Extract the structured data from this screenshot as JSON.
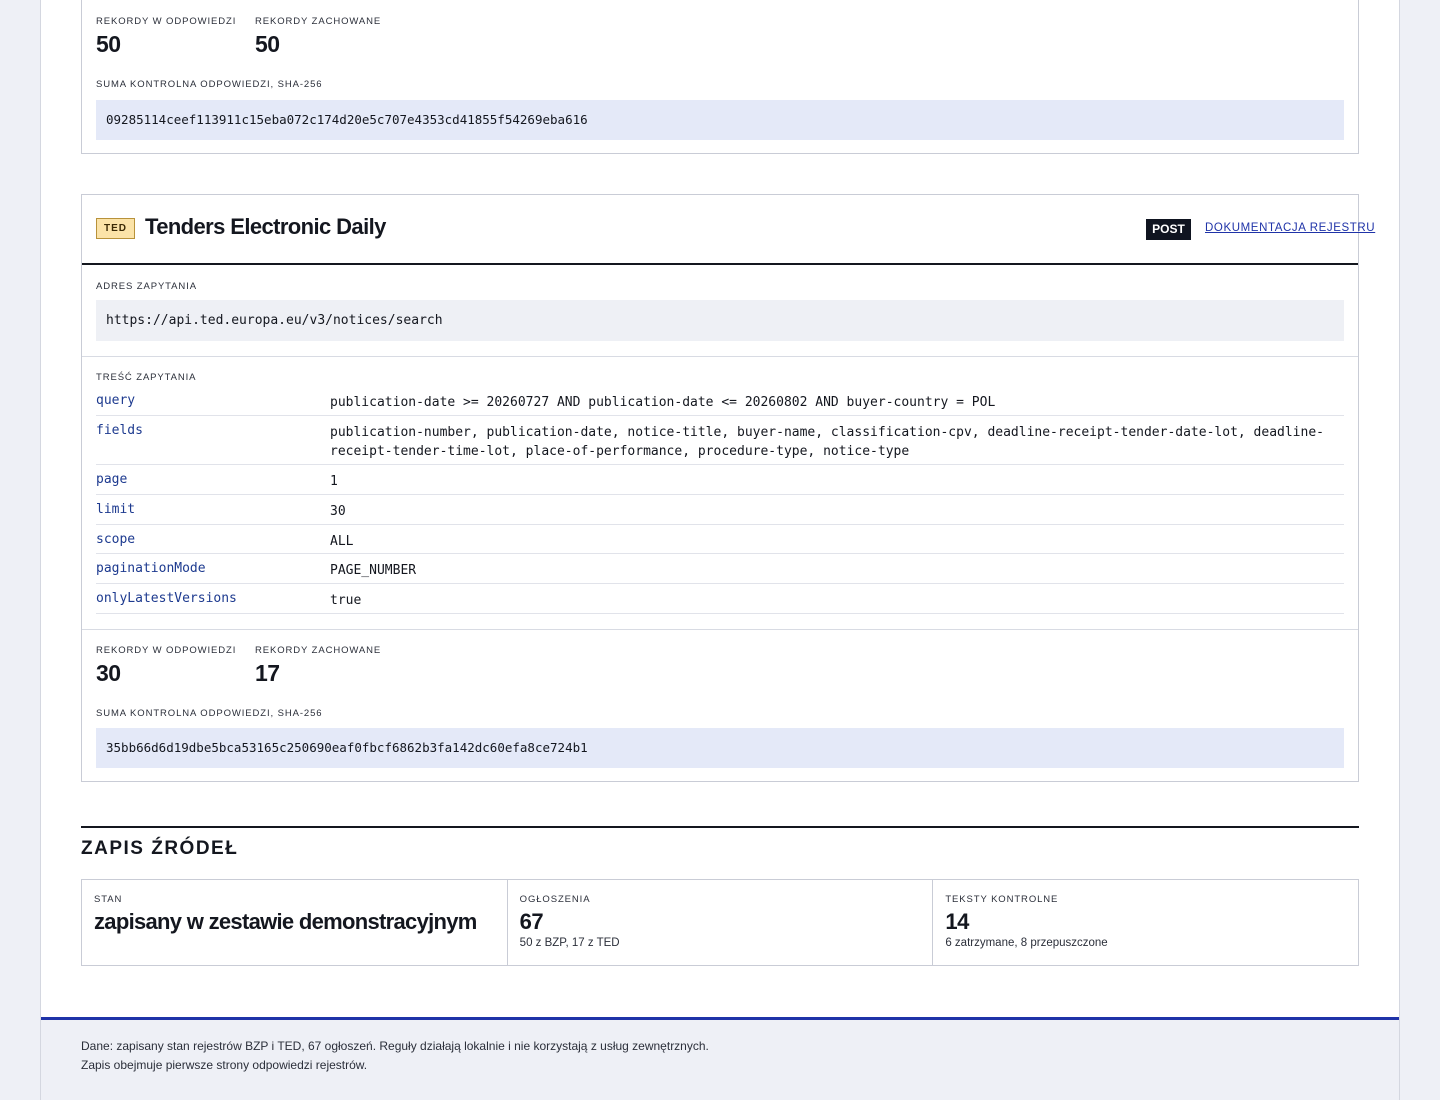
{
  "top_panel": {
    "records_response_label": "REKORDY W ODPOWIEDZI",
    "records_response_value": "50",
    "records_saved_label": "REKORDY ZACHOWANE",
    "records_saved_value": "50",
    "checksum_label": "SUMA KONTROLNA ODPOWIEDZI, SHA-256",
    "checksum_value": "09285114ceef113911c15eba072c174d20e5c707e4353cd41855f54269eba616"
  },
  "ted_panel": {
    "badge": "TED",
    "title": "Tenders Electronic Daily",
    "method": "POST",
    "doc_link": "DOKUMENTACJA REJESTRU",
    "url_label": "ADRES ZAPYTANIA",
    "url_value": "https://api.ted.europa.eu/v3/notices/search",
    "body_label": "TREŚĆ ZAPYTANIA",
    "params": [
      {
        "key": "query",
        "value": "publication-date >= 20260727 AND publication-date <= 20260802 AND buyer-country = POL"
      },
      {
        "key": "fields",
        "value": "publication-number, publication-date, notice-title, buyer-name, classification-cpv, deadline-receipt-tender-date-lot, deadline-receipt-tender-time-lot, place-of-performance, procedure-type, notice-type"
      },
      {
        "key": "page",
        "value": "1"
      },
      {
        "key": "limit",
        "value": "30"
      },
      {
        "key": "scope",
        "value": "ALL"
      },
      {
        "key": "paginationMode",
        "value": "PAGE_NUMBER"
      },
      {
        "key": "onlyLatestVersions",
        "value": "true"
      }
    ],
    "records_response_label": "REKORDY W ODPOWIEDZI",
    "records_response_value": "30",
    "records_saved_label": "REKORDY ZACHOWANE",
    "records_saved_value": "17",
    "checksum_label": "SUMA KONTROLNA ODPOWIEDZI, SHA-256",
    "checksum_value": "35bb66d6d19dbe5bca53165c250690eaf0fbcf6862b3fa142dc60efa8ce724b1"
  },
  "sources": {
    "heading": "ZAPIS ŹRÓDEŁ",
    "cells": [
      {
        "label": "STAN",
        "value": "zapisany w zestawie demonstracyjnym",
        "sub": ""
      },
      {
        "label": "OGŁOSZENIA",
        "value": "67",
        "sub": "50 z BZP, 17 z TED"
      },
      {
        "label": "TEKSTY KONTROLNE",
        "value": "14",
        "sub": "6 zatrzymane, 8 przepuszczone"
      }
    ]
  },
  "footer": {
    "text": "Dane: zapisany stan rejestrów BZP i TED, 67 ogłoszeń. Reguły działają lokalnie i nie korzystają z usług zewnętrznych. Zapis obejmuje pierwsze strony odpowiedzi rejestrów."
  },
  "colors": {
    "accent_blue": "#1f33a8",
    "badge_bg": "#fbe3a8",
    "hash_bg": "#e4e9f8",
    "param_key": "#1d3a8f"
  }
}
